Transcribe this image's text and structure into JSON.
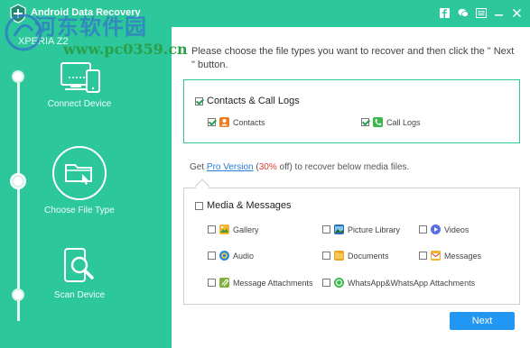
{
  "app": {
    "title": "Android Data Recovery",
    "titlebar_icons": [
      "facebook-icon",
      "chat-icon",
      "menu-icon",
      "minimize-icon",
      "close-icon"
    ]
  },
  "watermark": {
    "text": "河东软件园",
    "url": "www.pc0359.cn"
  },
  "sidebar": {
    "device_name": "XPERIA Z2",
    "steps": [
      {
        "label": "Connect Device",
        "icon": "devices-icon",
        "active": false
      },
      {
        "label": "Choose File Type",
        "icon": "folder-select-icon",
        "active": true
      },
      {
        "label": "Scan Device",
        "icon": "phone-scan-icon",
        "active": false
      }
    ]
  },
  "main": {
    "instruction": "Please choose the file types you want to recover and then click the \" Next \" button.",
    "group1": {
      "label": "Contacts & Call Logs",
      "checked": true,
      "items": [
        {
          "label": "Contacts",
          "checked": true,
          "icon": "contacts-icon",
          "color": "#f07a22"
        },
        {
          "label": "Call Logs",
          "checked": true,
          "icon": "call-logs-icon",
          "color": "#3cb54a"
        }
      ]
    },
    "promo": {
      "prefix": "Get ",
      "link": "Pro Version",
      "open": " (",
      "percent": "30%",
      "suffix": " off) to recover below media files."
    },
    "group2": {
      "label": "Media & Messages",
      "checked": false,
      "items": [
        {
          "label": "Gallery",
          "checked": false,
          "icon": "gallery-icon",
          "color": "#f2b632"
        },
        {
          "label": "Picture Library",
          "checked": false,
          "icon": "picture-library-icon",
          "color": "#2c6fb5"
        },
        {
          "label": "Videos",
          "checked": false,
          "icon": "videos-icon",
          "color": "#5b6ee6"
        },
        {
          "label": "Audio",
          "checked": false,
          "icon": "audio-icon",
          "color": "#2a88d8"
        },
        {
          "label": "Documents",
          "checked": false,
          "icon": "documents-icon",
          "color": "#e8a51f"
        },
        {
          "label": "Messages",
          "checked": false,
          "icon": "messages-icon",
          "color": "#f0b32b"
        },
        {
          "label": "Message Attachments",
          "checked": false,
          "icon": "attachments-icon",
          "color": "#7fb23a"
        },
        {
          "label": "WhatsApp&WhatsApp Attachments",
          "checked": false,
          "icon": "whatsapp-icon",
          "color": "#3cba4a"
        }
      ]
    },
    "next_label": "Next"
  }
}
